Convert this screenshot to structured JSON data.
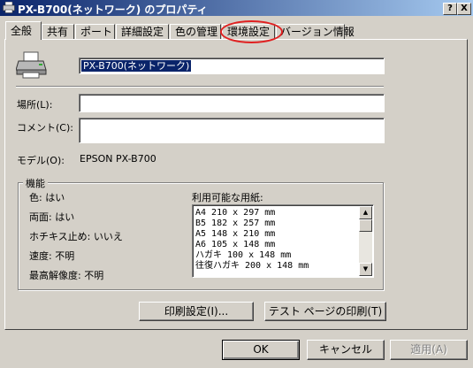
{
  "window": {
    "title": "PX-B700(ネットワーク) のプロパティ",
    "help_label": "?",
    "close_label": "X"
  },
  "tabs": [
    {
      "label": "全般"
    },
    {
      "label": "共有"
    },
    {
      "label": "ポート"
    },
    {
      "label": "詳細設定"
    },
    {
      "label": "色の管理"
    },
    {
      "label": "環境設定"
    },
    {
      "label": "バージョン情報"
    }
  ],
  "general": {
    "printer_name": "PX-B700(ネットワーク)",
    "location_label": "場所(L):",
    "location_value": "",
    "comment_label": "コメント(C):",
    "comment_value": "",
    "model_label": "モデル(O):",
    "model_value": "EPSON PX-B700"
  },
  "features": {
    "title": "機能",
    "color": "色: はい",
    "duplex": "両面: はい",
    "staple": "ホチキス止め: いいえ",
    "speed": "速度: 不明",
    "max_resolution": "最高解像度: 不明",
    "paper_label": "利用可能な用紙:",
    "paper_sizes": [
      "A4 210 x 297 mm",
      "B5 182 x 257 mm",
      "A5 148 x 210 mm",
      "A6 105 x 148 mm",
      "ハガキ 100 x 148 mm",
      "往復ハガキ 200 x 148 mm"
    ]
  },
  "buttons": {
    "print_settings": "印刷設定(I)...",
    "test_page": "テスト ページの印刷(T)",
    "ok": "OK",
    "cancel": "キャンセル",
    "apply": "適用(A)"
  },
  "colors": {
    "annotation_circle": "#e02020",
    "titlebar_start": "#0a246a"
  }
}
